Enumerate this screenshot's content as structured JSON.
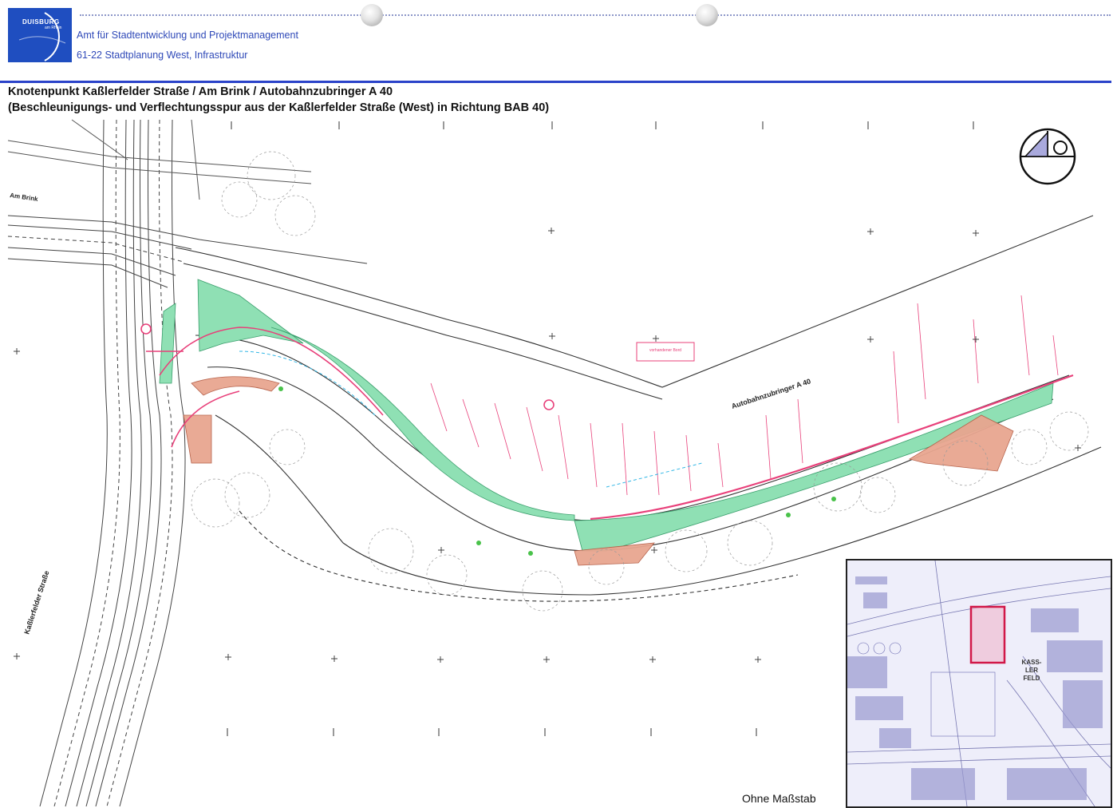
{
  "header": {
    "logo_text": "DUISBURG",
    "logo_sub": "am Rhein",
    "department": "Amt für Stadtentwicklung und Projektmanagement",
    "division": "61-22 Stadtplanung West, Infrastruktur"
  },
  "title": {
    "line1": "Knotenpunkt  Kaßlerfelder Straße / Am Brink / Autobahnzubringer A 40",
    "line2": "(Beschleunigungs- und Verflechtungsspur aus der Kaßlerfelder Straße (West) in Richtung BAB 40)"
  },
  "map": {
    "street_am_brink": "Am Brink",
    "street_kasslerfelder": "Kaßlerfelder Straße",
    "street_a40": "Autobahnzubringer A 40",
    "note_box": "vorhandener Bord"
  },
  "inset": {
    "district": "KASS-\nLER\nFELD"
  },
  "scale": "Ohne Maßstab",
  "colors": {
    "accent_blue": "#2b43c9",
    "green_area": "#8fe0b4",
    "red_area": "#e8a690",
    "pink_lines": "#e8407a"
  }
}
